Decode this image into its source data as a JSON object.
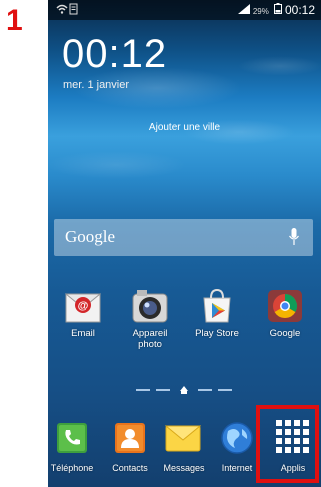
{
  "step": {
    "number": "1"
  },
  "status_bar": {
    "battery_percent": "29%",
    "time": "00:12"
  },
  "lockscreen_widget": {
    "clock": "00:12",
    "date": "mer. 1 janvier",
    "add_city": "Ajouter une ville"
  },
  "search": {
    "label": "Google"
  },
  "apps": [
    {
      "label": "Email",
      "icon": "email-icon"
    },
    {
      "label": "Appareil photo",
      "icon": "camera-icon"
    },
    {
      "label": "Play Store",
      "icon": "play-store-icon"
    },
    {
      "label": "Google",
      "icon": "google-folder-icon"
    }
  ],
  "dock": [
    {
      "label": "Téléphone",
      "icon": "phone-icon"
    },
    {
      "label": "Contacts",
      "icon": "contacts-icon"
    },
    {
      "label": "Messages",
      "icon": "messages-icon"
    },
    {
      "label": "Internet",
      "icon": "internet-icon"
    },
    {
      "label": "Applis",
      "icon": "apps-grid-icon"
    }
  ],
  "colors": {
    "highlight": "#e01010",
    "step_number": "#e01010"
  }
}
